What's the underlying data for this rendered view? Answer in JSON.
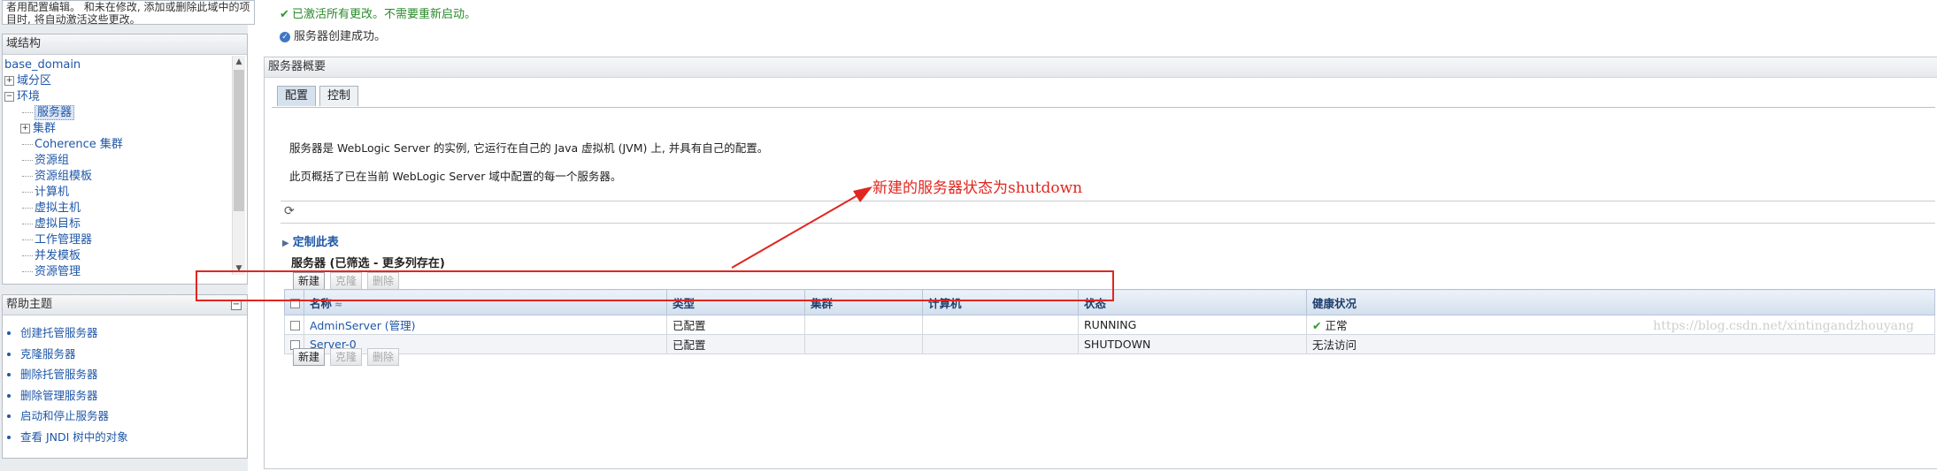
{
  "left": {
    "notice_text": "者用配置编辑。 和未在修改, 添加或删除此域中的项目时, 将自动激活这些更改。",
    "domain_structure": {
      "title": "域结构",
      "items": [
        {
          "label": "base_domain",
          "level": 0
        },
        {
          "label": "域分区",
          "level": 1,
          "expander": "+"
        },
        {
          "label": "环境",
          "level": 1,
          "expander": "-"
        },
        {
          "label": "服务器",
          "level": 2,
          "selected": true
        },
        {
          "label": "集群",
          "level": 2,
          "expander": "+"
        },
        {
          "label": "Coherence 集群",
          "level": 2
        },
        {
          "label": "资源组",
          "level": 2
        },
        {
          "label": "资源组模板",
          "level": 2
        },
        {
          "label": "计算机",
          "level": 2
        },
        {
          "label": "虚拟主机",
          "level": 2
        },
        {
          "label": "虚拟目标",
          "level": 2
        },
        {
          "label": "工作管理器",
          "level": 2
        },
        {
          "label": "并发模板",
          "level": 2
        },
        {
          "label": "资源管理",
          "level": 2
        }
      ]
    },
    "help": {
      "title": "帮助主题",
      "items": [
        "创建托管服务器",
        "克隆服务器",
        "删除托管服务器",
        "删除管理服务器",
        "启动和停止服务器",
        "查看 JNDI 树中的对象"
      ]
    }
  },
  "messages": {
    "activated": "已激活所有更改。不需要重新启动。",
    "created": "服务器创建成功。"
  },
  "summary": {
    "title": "服务器概要",
    "tabs": [
      "配置",
      "控制"
    ],
    "desc1": "服务器是 WebLogic Server 的实例, 它运行在自己的 Java 虚拟机 (JVM) 上, 并具有自己的配置。",
    "desc2": "此页概括了已在当前 WebLogic Server 域中配置的每一个服务器。",
    "customize": "定制此表",
    "table_caption": "服务器 (已筛选 - 更多列存在)",
    "buttons": {
      "new": "新建",
      "clone": "克隆",
      "delete": "删除"
    },
    "columns": [
      "名称",
      "类型",
      "集群",
      "计算机",
      "状态",
      "健康状况"
    ],
    "rows": [
      {
        "name": "AdminServer (管理)",
        "type": "已配置",
        "cluster": "",
        "machine": "",
        "state": "RUNNING",
        "health": "正常"
      },
      {
        "name": "Server-0",
        "type": "已配置",
        "cluster": "",
        "machine": "",
        "state": "SHUTDOWN",
        "health": "无法访问"
      }
    ]
  },
  "annotation": {
    "text": "新建的服务器状态为shutdown",
    "color": "#e0261f"
  },
  "watermark": "https://blog.csdn.net/xintingandzhouyang"
}
